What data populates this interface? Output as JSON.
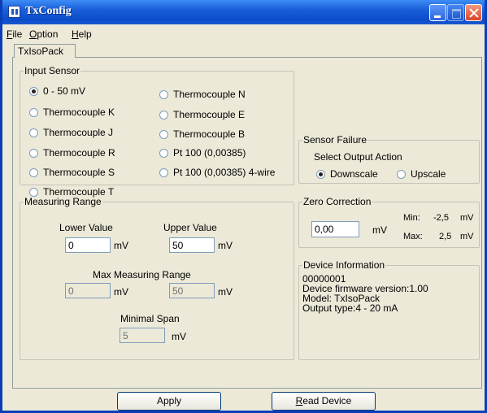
{
  "window": {
    "title": "TxConfig"
  },
  "menu": [
    {
      "mnemonic": "F",
      "rest": "ile"
    },
    {
      "mnemonic": "O",
      "rest": "ption"
    },
    {
      "mnemonic": "H",
      "rest": "elp"
    }
  ],
  "tab": {
    "label": "TxIsoPack"
  },
  "input_sensor": {
    "legend": "Input Sensor",
    "selected": "0 - 50 mV",
    "options": [
      "0 - 50 mV",
      "Thermocouple K",
      "Thermocouple J",
      "Thermocouple R",
      "Thermocouple S",
      "Thermocouple T",
      "Thermocouple N",
      "Thermocouple E",
      "Thermocouple B",
      "Pt 100 (0,00385)",
      "Pt 100 (0,00385) 4-wire"
    ]
  },
  "sensor_failure": {
    "legend": "Sensor Failure",
    "prompt": "Select Output Action",
    "options": [
      "Downscale",
      "Upscale"
    ],
    "selected": "Downscale"
  },
  "measuring_range": {
    "legend": "Measuring Range",
    "lower_label": "Lower Value",
    "lower_value": "0",
    "upper_label": "Upper Value",
    "upper_value": "50",
    "max_label": "Max Measuring Range",
    "max_lower": "0",
    "max_upper": "50",
    "span_label": "Minimal Span",
    "span_value": "5",
    "unit": "mV"
  },
  "zero_correction": {
    "legend": "Zero Correction",
    "value": "0,00",
    "unit": "mV",
    "min_label": "Min:",
    "min_value": "-2,5",
    "max_label": "Max:",
    "max_value": "2,5"
  },
  "device_info": {
    "legend": "Device Information",
    "lines": [
      "00000001",
      "Device firmware version:1.00",
      "Model: TxIsoPack",
      "Output type:4 - 20 mA"
    ]
  },
  "buttons": {
    "apply": {
      "mnemonic": "",
      "rest": "Apply"
    },
    "read_device": {
      "mnemonic": "R",
      "rest": "ead Device"
    }
  }
}
